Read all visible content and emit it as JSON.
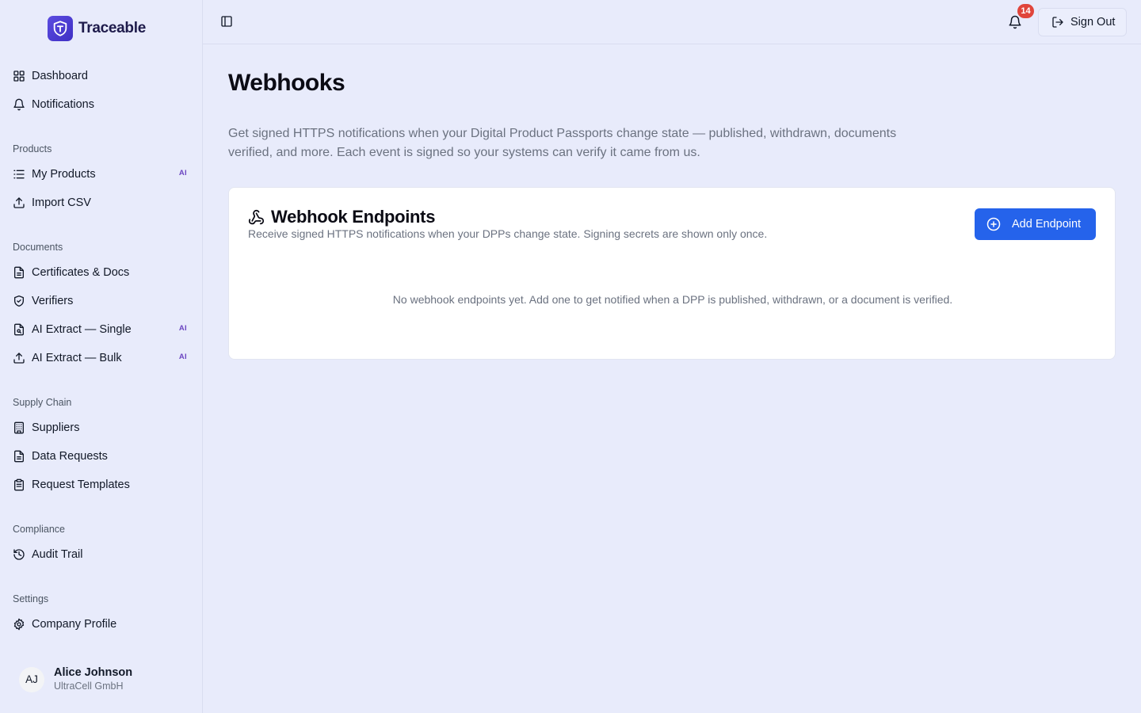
{
  "brand": {
    "name": "Traceable",
    "accent": "#4f3fd6"
  },
  "sidebar": {
    "top_items": [
      {
        "label": "Dashboard",
        "icon": "grid-icon"
      },
      {
        "label": "Notifications",
        "icon": "bell-icon"
      }
    ],
    "sections": [
      {
        "label": "Products",
        "items": [
          {
            "label": "My Products",
            "icon": "list-icon",
            "badge": "AI"
          },
          {
            "label": "Import CSV",
            "icon": "upload-icon"
          }
        ]
      },
      {
        "label": "Documents",
        "items": [
          {
            "label": "Certificates & Docs",
            "icon": "file-icon"
          },
          {
            "label": "Verifiers",
            "icon": "shield-icon"
          },
          {
            "label": "AI Extract — Single",
            "icon": "file-scan-icon",
            "badge": "AI"
          },
          {
            "label": "AI Extract — Bulk",
            "icon": "upload-icon",
            "badge": "AI"
          }
        ]
      },
      {
        "label": "Supply Chain",
        "items": [
          {
            "label": "Suppliers",
            "icon": "building-icon"
          },
          {
            "label": "Data Requests",
            "icon": "file-icon"
          },
          {
            "label": "Request Templates",
            "icon": "clipboard-icon"
          }
        ]
      },
      {
        "label": "Compliance",
        "items": [
          {
            "label": "Audit Trail",
            "icon": "history-icon"
          }
        ]
      },
      {
        "label": "Settings",
        "items": [
          {
            "label": "Company Profile",
            "icon": "gear-icon"
          }
        ]
      }
    ],
    "user": {
      "initials": "AJ",
      "name": "Alice Johnson",
      "company": "UltraCell GmbH"
    }
  },
  "topbar": {
    "notification_count": "14",
    "sign_out_label": "Sign Out"
  },
  "main": {
    "title": "Webhooks",
    "description": "Get signed HTTPS notifications when your Digital Product Passports change state — published, withdrawn, documents verified, and more. Each event is signed so your systems can verify it came from us.",
    "card": {
      "title": "Webhook Endpoints",
      "subtitle": "Receive signed HTTPS notifications when your DPPs change state. Signing secrets are shown only once.",
      "add_label": "Add Endpoint",
      "empty_text": "No webhook endpoints yet. Add one to get notified when a DPP is published, withdrawn, or a document is verified.",
      "button_color": "#2563eb"
    }
  }
}
